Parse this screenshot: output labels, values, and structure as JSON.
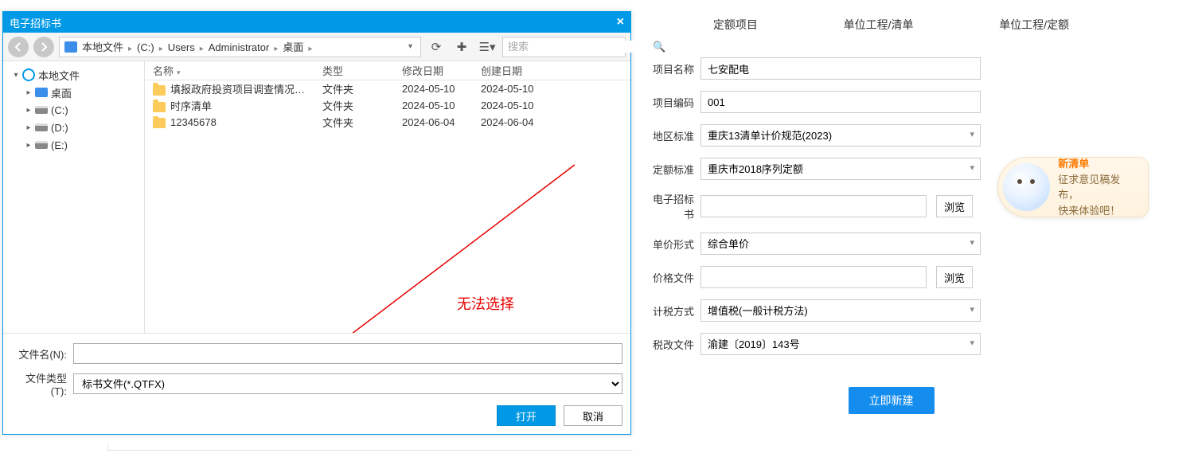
{
  "dialog": {
    "title": "电子招标书",
    "breadcrumb": [
      "本地文件",
      "(C:)",
      "Users",
      "Administrator",
      "桌面"
    ],
    "search_placeholder": "搜索",
    "tree": [
      {
        "label": "本地文件",
        "icon": "clock",
        "expanded": true,
        "indent": false
      },
      {
        "label": "桌面",
        "icon": "monitor",
        "expanded": false,
        "indent": true
      },
      {
        "label": "(C:)",
        "icon": "drive",
        "expanded": false,
        "indent": true
      },
      {
        "label": "(D:)",
        "icon": "drive",
        "expanded": false,
        "indent": true
      },
      {
        "label": "(E:)",
        "icon": "drive",
        "expanded": false,
        "indent": true
      }
    ],
    "columns": {
      "name": "名称",
      "type": "类型",
      "modified": "修改日期",
      "created": "创建日期"
    },
    "rows": [
      {
        "name": "填报政府投资项目调查情况表的...",
        "type": "文件夹",
        "modified": "2024-05-10",
        "created": "2024-05-10"
      },
      {
        "name": "时序清单",
        "type": "文件夹",
        "modified": "2024-05-10",
        "created": "2024-05-10"
      },
      {
        "name": "12345678",
        "type": "文件夹",
        "modified": "2024-06-04",
        "created": "2024-06-04"
      }
    ],
    "filename_label": "文件名(N):",
    "filename_value": "",
    "filetype_label": "文件类型(T):",
    "filetype_value": "标书文件(*.QTFX)",
    "open_label": "打开",
    "cancel_label": "取消",
    "annotation": "无法选择"
  },
  "tabs": [
    "定额项目",
    "单位工程/清单",
    "单位工程/定额"
  ],
  "form": {
    "project_name": {
      "label": "项目名称",
      "value": "七安配电"
    },
    "project_code": {
      "label": "项目编码",
      "value": "001"
    },
    "region_std": {
      "label": "地区标准",
      "value": "重庆13清单计价规范(2023)"
    },
    "quota_std": {
      "label": "定额标准",
      "value": "重庆市2018序列定额"
    },
    "ebid": {
      "label": "电子招标书",
      "value": "",
      "browse": "浏览"
    },
    "price_form": {
      "label": "单价形式",
      "value": "综合单价"
    },
    "price_file": {
      "label": "价格文件",
      "value": "",
      "browse": "浏览"
    },
    "tax_method": {
      "label": "计税方式",
      "value": "增值税(一般计税方法)"
    },
    "tax_doc": {
      "label": "税改文件",
      "value": "渝建〔2019〕143号"
    },
    "create": "立即新建"
  },
  "notif": {
    "title": "新清单",
    "body1": "征求意见稿发布，",
    "body2": "快来体验吧！"
  }
}
